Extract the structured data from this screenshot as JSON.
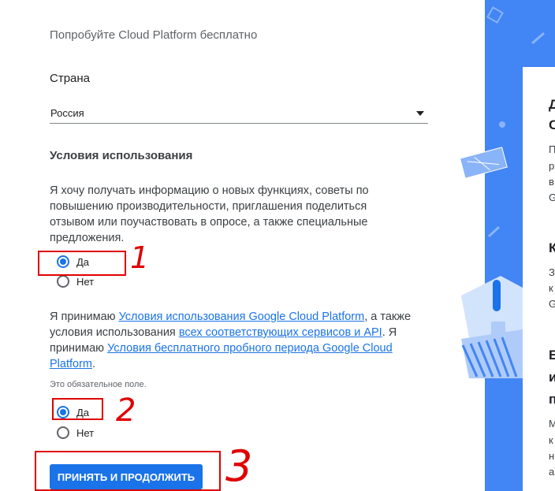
{
  "form": {
    "heading": "Попробуйте Cloud Platform бесплатно",
    "country_label": "Страна",
    "country_value": "Россия",
    "terms_title": "Условия использования",
    "newsletter_text": "Я хочу получать информацию о новых функциях, советы по повышению производительности, приглашения поделиться отзывом или поучаствовать в опросе, а также специальные предложения.",
    "newsletter_options": [
      {
        "label": "Да",
        "checked": true
      },
      {
        "label": "Нет",
        "checked": false
      }
    ],
    "tos": {
      "text1": "Я принимаю ",
      "link1": "Условия использования Google Cloud Platform",
      "text2": ", а также условия использования ",
      "link2": "всех соответствующих сервисов и API",
      "text3": ". Я принимаю ",
      "link3": "Условия бесплатного пробного периода Google Cloud Platform",
      "text4": "."
    },
    "required_note": "Это обязательное поле.",
    "tos_options": [
      {
        "label": "Да",
        "checked": true
      },
      {
        "label": "Нет",
        "checked": false
      }
    ],
    "submit_label": "ПРИНЯТЬ И ПРОДОЛЖИТЬ"
  },
  "annotations": {
    "num1": "1",
    "num2": "2",
    "num3": "3"
  },
  "side_panel": {
    "lines": [
      "Д",
      "С",
      "П",
      "р",
      "в",
      "G",
      "К",
      "З",
      "к",
      "G",
      "Е",
      "и",
      "п",
      "М",
      "к",
      "н",
      "а"
    ]
  },
  "colors": {
    "accent": "#1a73e8",
    "panel_blue": "#4285f4",
    "annotation_red": "#e00000"
  }
}
